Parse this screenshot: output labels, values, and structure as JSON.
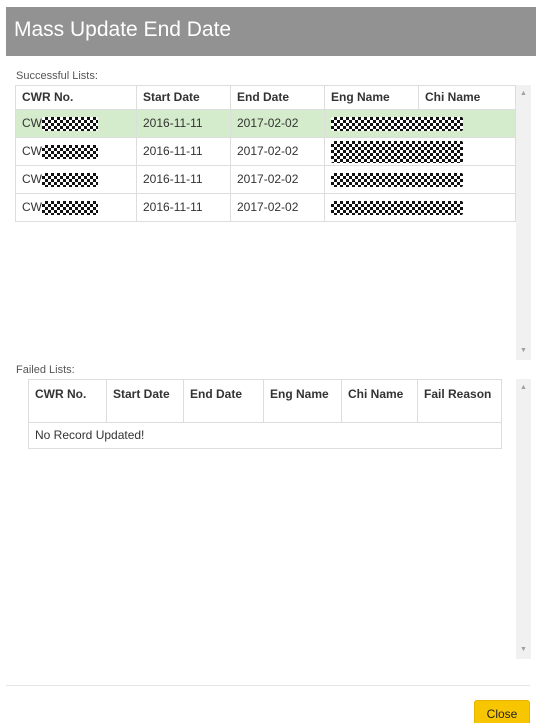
{
  "dialog": {
    "title": "Mass Update End Date",
    "close_label": "Close"
  },
  "successful": {
    "label": "Successful Lists:",
    "columns": [
      "CWR No.",
      "Start Date",
      "End Date",
      "Eng Name",
      "Chi Name"
    ],
    "rows": [
      {
        "cwr_prefix": "CW",
        "start_date": "2016-11-11",
        "end_date": "2017-02-02",
        "selected": true
      },
      {
        "cwr_prefix": "CW",
        "start_date": "2016-11-11",
        "end_date": "2017-02-02",
        "selected": false
      },
      {
        "cwr_prefix": "CW",
        "start_date": "2016-11-11",
        "end_date": "2017-02-02",
        "selected": false
      },
      {
        "cwr_prefix": "CW",
        "start_date": "2016-11-11",
        "end_date": "2017-02-02",
        "selected": false
      }
    ]
  },
  "failed": {
    "label": "Failed Lists:",
    "columns": [
      "CWR No.",
      "Start Date",
      "End Date",
      "Eng Name",
      "Chi Name",
      "Fail Reason"
    ],
    "empty_message": "No Record Updated!"
  },
  "icons": {
    "scroll_up": "scroll-up-arrow-icon",
    "scroll_down": "scroll-down-arrow-icon"
  },
  "colors": {
    "header_bg": "#929292",
    "selected_row": "#d4eccb",
    "close_button": "#f7c600"
  }
}
